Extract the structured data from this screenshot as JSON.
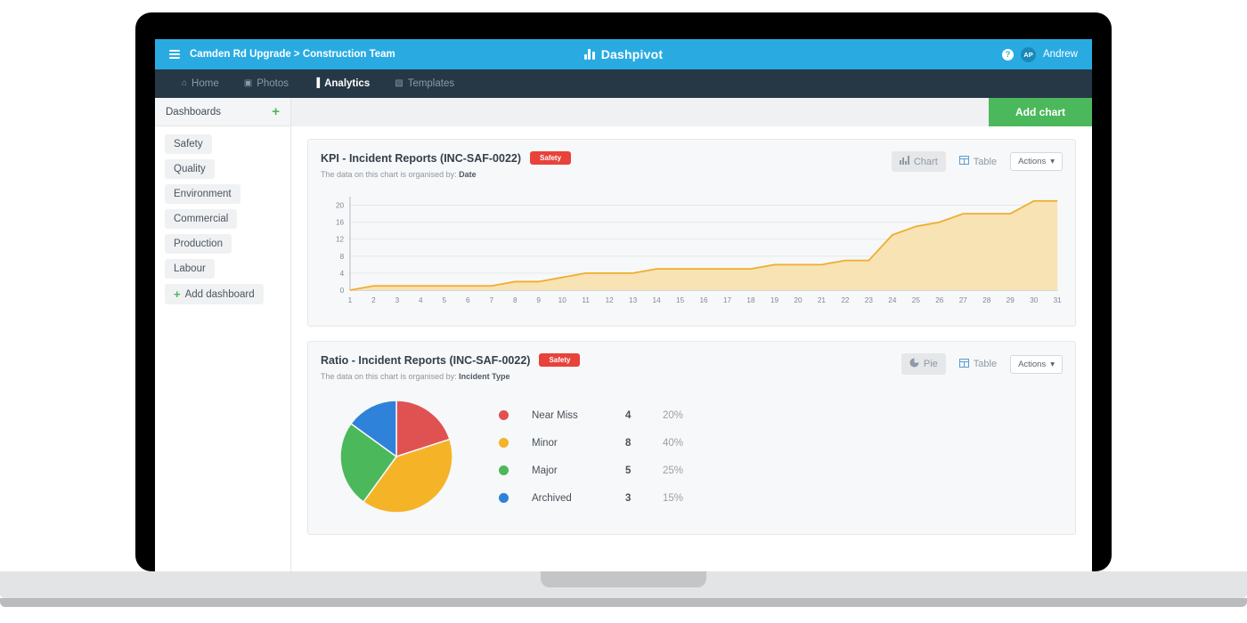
{
  "topbar": {
    "menu_icon": "hamburger-icon",
    "breadcrumb": "Camden Rd Upgrade > Construction Team",
    "brand_name": "Dashpivot",
    "brand_logo_icon": "bar-chart-logo-icon",
    "help_icon": "?",
    "avatar_initials": "AP",
    "user_name": "Andrew",
    "accent_color": "#29abe2"
  },
  "nav": {
    "items": [
      {
        "label": "Home",
        "icon": "home-icon",
        "glyph": "⌂",
        "active": false
      },
      {
        "label": "Photos",
        "icon": "camera-icon",
        "glyph": "▣",
        "active": false
      },
      {
        "label": "Analytics",
        "icon": "analytics-icon",
        "glyph": "▐",
        "active": true
      },
      {
        "label": "Templates",
        "icon": "document-icon",
        "glyph": "▧",
        "active": false
      }
    ],
    "background_color": "#263746"
  },
  "sidebar": {
    "title": "Dashboards",
    "add_icon": "plus-icon",
    "items": [
      {
        "label": "Safety"
      },
      {
        "label": "Quality"
      },
      {
        "label": "Environment"
      },
      {
        "label": "Commercial"
      },
      {
        "label": "Production"
      },
      {
        "label": "Labour"
      }
    ],
    "add_dashboard_label": "Add dashboard",
    "add_dashboard_icon": "plus-icon"
  },
  "main": {
    "add_chart_label": "Add chart",
    "add_chart_color": "#4cb85c"
  },
  "cards": [
    {
      "title": "KPI - Incident Reports (INC-SAF-0022)",
      "badge": "Safety",
      "badge_color": "#e8423b",
      "subtitle_prefix": "The data on this chart is organised by:",
      "subtitle_value": "Date",
      "view_chart_label": "Chart",
      "view_chart_icon": "bar-chart-icon",
      "view_table_label": "Table",
      "view_table_icon": "table-icon",
      "actions_label": "Actions",
      "actions_caret_icon": "caret-down-icon",
      "active_view": "Chart"
    },
    {
      "title": "Ratio - Incident Reports (INC-SAF-0022)",
      "badge": "Safety",
      "badge_color": "#e8423b",
      "subtitle_prefix": "The data on this chart is organised by:",
      "subtitle_value": "Incident Type",
      "view_chart_label": "Pie",
      "view_chart_icon": "pie-chart-icon",
      "view_table_label": "Table",
      "view_table_icon": "table-icon",
      "actions_label": "Actions",
      "actions_caret_icon": "caret-down-icon",
      "active_view": "Pie"
    }
  ],
  "chart_data": [
    {
      "type": "area",
      "title": "KPI - Incident Reports (INC-SAF-0022)",
      "xlabel": "",
      "ylabel": "",
      "x": [
        1,
        2,
        3,
        4,
        5,
        6,
        7,
        8,
        9,
        10,
        11,
        12,
        13,
        14,
        15,
        16,
        17,
        18,
        19,
        20,
        21,
        22,
        23,
        24,
        25,
        26,
        27,
        28,
        29,
        30,
        31
      ],
      "values": [
        0,
        1,
        1,
        1,
        1,
        1,
        1,
        2,
        2,
        3,
        4,
        4,
        4,
        5,
        5,
        5,
        5,
        5,
        6,
        6,
        6,
        7,
        7,
        13,
        15,
        16,
        18,
        18,
        18,
        21,
        21
      ],
      "ytick_labels": [
        "0",
        "4",
        "8",
        "12",
        "16",
        "20"
      ],
      "yticks": [
        0,
        4,
        8,
        12,
        16,
        20
      ],
      "xtick_labels": [
        "1",
        "2",
        "3",
        "4",
        "5",
        "6",
        "7",
        "8",
        "9",
        "10",
        "11",
        "12",
        "13",
        "14",
        "15",
        "16",
        "17",
        "18",
        "19",
        "20",
        "21",
        "22",
        "23",
        "24",
        "25",
        "26",
        "27",
        "28",
        "29",
        "30",
        "31"
      ],
      "ylim": [
        0,
        22
      ],
      "grid": true,
      "legend": "none",
      "line_color": "#f0ad2e",
      "fill_color": "#f8e3b4"
    },
    {
      "type": "pie",
      "title": "Ratio - Incident Reports (INC-SAF-0022)",
      "labels": [
        "Near Miss",
        "Minor",
        "Major",
        "Archived"
      ],
      "values": [
        4,
        8,
        5,
        3
      ],
      "percents": [
        "20%",
        "40%",
        "25%",
        "15%"
      ],
      "percent_values": [
        20,
        40,
        25,
        15
      ],
      "colors": [
        "#e05252",
        "#f5b328",
        "#4cb85c",
        "#2e82d9"
      ],
      "legend": "right",
      "start_angle_deg": 0
    }
  ]
}
